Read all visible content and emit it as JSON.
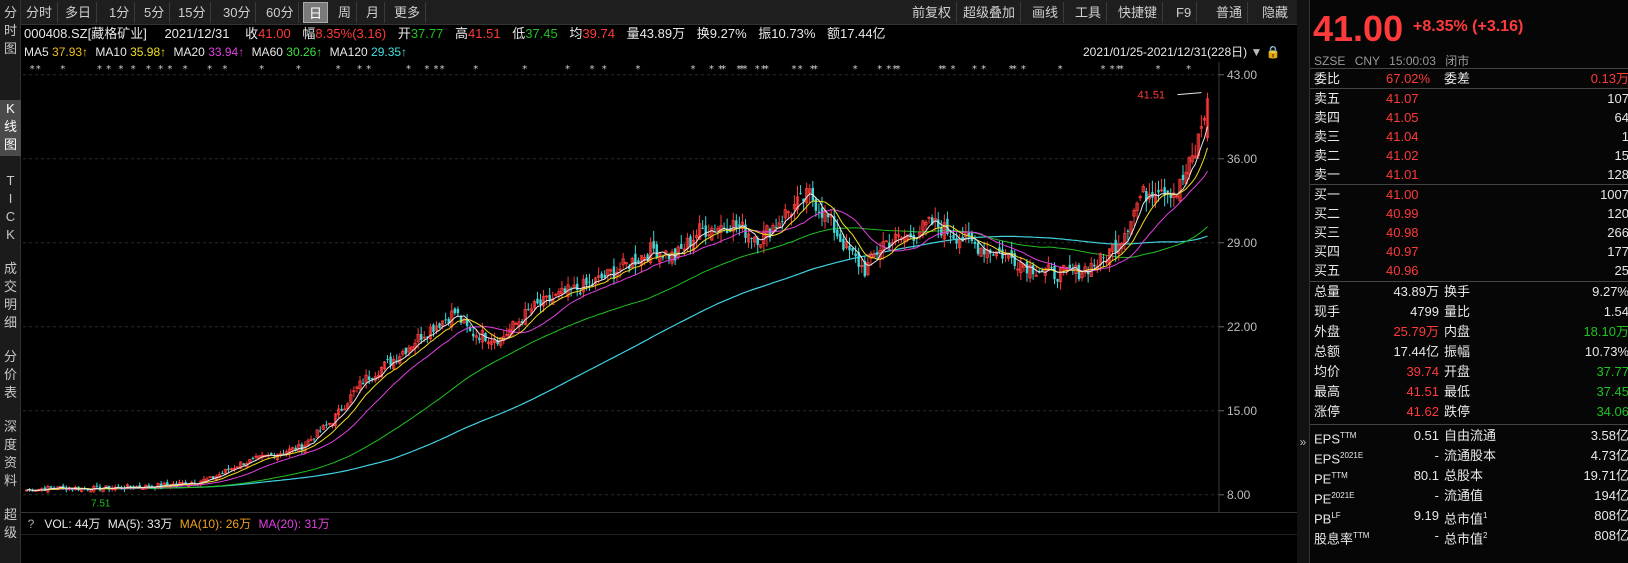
{
  "leftnav": [
    {
      "label": "分\n时\n图",
      "top": 0,
      "active": false
    },
    {
      "label": "K\n线\n图",
      "top": 0,
      "active": true
    },
    {
      "label": "T\nI\nC\nK",
      "top": 0,
      "active": false
    },
    {
      "label": "成\n交\n明\n细",
      "top": 0,
      "active": false
    },
    {
      "label": "分\n价\n表",
      "top": 0,
      "active": false
    },
    {
      "label": "深\n度\n资\n料",
      "top": 0,
      "active": false
    },
    {
      "label": "超\n级",
      "top": 0,
      "active": false
    }
  ],
  "toolbar": {
    "periods": [
      "分时",
      "多日",
      "1分",
      "5分",
      "15分",
      "30分",
      "60分",
      "日",
      "周",
      "月",
      "更多"
    ],
    "active_period": "日",
    "tools": [
      "前复权",
      "超级叠加",
      "画线",
      "工具",
      "快捷键",
      "F9",
      "普通",
      "隐藏"
    ]
  },
  "quote_line": {
    "code": "000408.SZ[藏格矿业]",
    "date": "2021/12/31",
    "close_label": "收",
    "close": "41.00",
    "chg_label": "幅",
    "chg": "8.35%(3.16)",
    "open_label": "开",
    "open": "37.77",
    "high_label": "高",
    "high": "41.51",
    "low_label": "低",
    "low": "37.45",
    "avg_label": "均",
    "avg": "39.74",
    "vol_label": "量",
    "vol": "43.89万",
    "turn_label": "换",
    "turn": "9.27%",
    "amp_label": "振",
    "amp": "10.73%",
    "amt_label": "额",
    "amt": "17.44亿"
  },
  "ma_line": {
    "ma5": "MA5",
    "ma5v": "37.93↑",
    "ma10": "MA10",
    "ma10v": "35.98↑",
    "ma20": "MA20",
    "ma20v": "33.94↑",
    "ma60": "MA60",
    "ma60v": "30.26↑",
    "ma120": "MA120",
    "ma120v": "29.35↑",
    "range": "2021/01/25-2021/12/31(228日)"
  },
  "chart_data": {
    "type": "candlestick",
    "y_ticks": [
      "43.00",
      "36.00",
      "29.00",
      "22.00",
      "15.00",
      "8.00"
    ],
    "y_tick_values": [
      43,
      36,
      29,
      22,
      15,
      8
    ],
    "ylim": [
      7.4,
      43.4
    ],
    "high_marker": "41.51",
    "low_marker": "7.51",
    "anchors": [
      [
        0,
        8.4
      ],
      [
        10,
        8.6
      ],
      [
        20,
        8.5
      ],
      [
        30,
        8.6
      ],
      [
        40,
        8.7
      ],
      [
        50,
        8.9
      ],
      [
        60,
        9.3
      ],
      [
        70,
        10.6
      ],
      [
        80,
        11.3
      ],
      [
        90,
        12.0
      ],
      [
        100,
        14.2
      ],
      [
        110,
        17.5
      ],
      [
        120,
        19.3
      ],
      [
        130,
        21.5
      ],
      [
        140,
        23.2
      ],
      [
        145,
        21.5
      ],
      [
        155,
        21.0
      ],
      [
        165,
        23.5
      ],
      [
        175,
        24.7
      ],
      [
        185,
        25.6
      ],
      [
        195,
        27.0
      ],
      [
        205,
        28.5
      ],
      [
        212,
        27.8
      ],
      [
        220,
        30.0
      ],
      [
        230,
        30.6
      ],
      [
        240,
        29.4
      ],
      [
        248,
        31.4
      ],
      [
        256,
        33.0
      ],
      [
        262,
        31.0
      ],
      [
        268,
        28.5
      ],
      [
        274,
        26.7
      ],
      [
        280,
        29.0
      ],
      [
        288,
        29.5
      ],
      [
        296,
        30.6
      ],
      [
        304,
        29.6
      ],
      [
        312,
        28.6
      ],
      [
        320,
        28.0
      ],
      [
        328,
        27.0
      ],
      [
        336,
        26.4
      ],
      [
        344,
        26.6
      ],
      [
        352,
        27.6
      ],
      [
        358,
        29.5
      ],
      [
        364,
        32.8
      ],
      [
        370,
        33.8
      ],
      [
        376,
        33.2
      ],
      [
        382,
        36.5
      ],
      [
        386,
        41.0
      ]
    ],
    "volume_line": {
      "vol_label": "VOL: 44万",
      "ma5_label": "MA(5): 33万",
      "ma10_label": "MA(10): 26万",
      "ma20_label": "MA(20): 31万"
    }
  },
  "right": {
    "price": "41.00",
    "change": "+8.35% (+3.16)",
    "exch": "SZSE",
    "currency": "CNY",
    "time": "15:00:03",
    "status": "闭市",
    "weibi_label": "委比",
    "weibi": "67.02%",
    "weicha_label": "委差",
    "weicha": "0.13万",
    "asks": [
      {
        "label": "卖五",
        "price": "41.07",
        "vol": "107"
      },
      {
        "label": "卖四",
        "price": "41.05",
        "vol": "64"
      },
      {
        "label": "卖三",
        "price": "41.04",
        "vol": "1"
      },
      {
        "label": "卖二",
        "price": "41.02",
        "vol": "15"
      },
      {
        "label": "卖一",
        "price": "41.01",
        "vol": "128"
      }
    ],
    "bids": [
      {
        "label": "买一",
        "price": "41.00",
        "vol": "1007"
      },
      {
        "label": "买二",
        "price": "40.99",
        "vol": "120"
      },
      {
        "label": "买三",
        "price": "40.98",
        "vol": "266"
      },
      {
        "label": "买四",
        "price": "40.97",
        "vol": "177"
      },
      {
        "label": "买五",
        "price": "40.96",
        "vol": "25"
      }
    ],
    "stats": [
      {
        "l1": "总量",
        "v1": "43.89万",
        "c1": "white",
        "l2": "换手",
        "v2": "9.27%",
        "c2": "white"
      },
      {
        "l1": "现手",
        "v1": "4799",
        "c1": "white",
        "l2": "量比",
        "v2": "1.54",
        "c2": "white"
      },
      {
        "l1": "外盘",
        "v1": "25.79万",
        "c1": "red",
        "l2": "内盘",
        "v2": "18.10万",
        "c2": "green"
      },
      {
        "l1": "总额",
        "v1": "17.44亿",
        "c1": "white",
        "l2": "振幅",
        "v2": "10.73%",
        "c2": "white"
      },
      {
        "l1": "均价",
        "v1": "39.74",
        "c1": "red",
        "l2": "开盘",
        "v2": "37.77",
        "c2": "green"
      },
      {
        "l1": "最高",
        "v1": "41.51",
        "c1": "red",
        "l2": "最低",
        "v2": "37.45",
        "c2": "green"
      },
      {
        "l1": "涨停",
        "v1": "41.62",
        "c1": "red",
        "l2": "跌停",
        "v2": "34.06",
        "c2": "green"
      }
    ],
    "fundamentals": [
      {
        "l1": "EPS",
        "s1": "TTM",
        "v1": "0.51",
        "l2": "自由流通",
        "s2": "",
        "v2": "3.58亿"
      },
      {
        "l1": "EPS",
        "s1": "2021E",
        "v1": "-",
        "l2": "流通股本",
        "s2": "",
        "v2": "4.73亿"
      },
      {
        "l1": "PE",
        "s1": "TTM",
        "v1": "80.1",
        "l2": "总股本",
        "s2": "",
        "v2": "19.71亿"
      },
      {
        "l1": "PE",
        "s1": "2021E",
        "v1": "-",
        "l2": "流通值",
        "s2": "",
        "v2": "194亿"
      },
      {
        "l1": "PB",
        "s1": "LF",
        "v1": "9.19",
        "l2": "总市值",
        "s2": "1",
        "v2": "808亿"
      },
      {
        "l1": "股息率",
        "s1": "TTM",
        "v1": "-",
        "l2": "总市值",
        "s2": "2",
        "v2": "808亿"
      }
    ],
    "colors": {
      "up": "#ff3a3a",
      "down": "#3fd6d6",
      "ma5": "#e8e8e8",
      "ma10": "#f0e020",
      "ma20": "#e040e0",
      "ma60": "#21c121",
      "ma120": "#40d0e0"
    }
  }
}
